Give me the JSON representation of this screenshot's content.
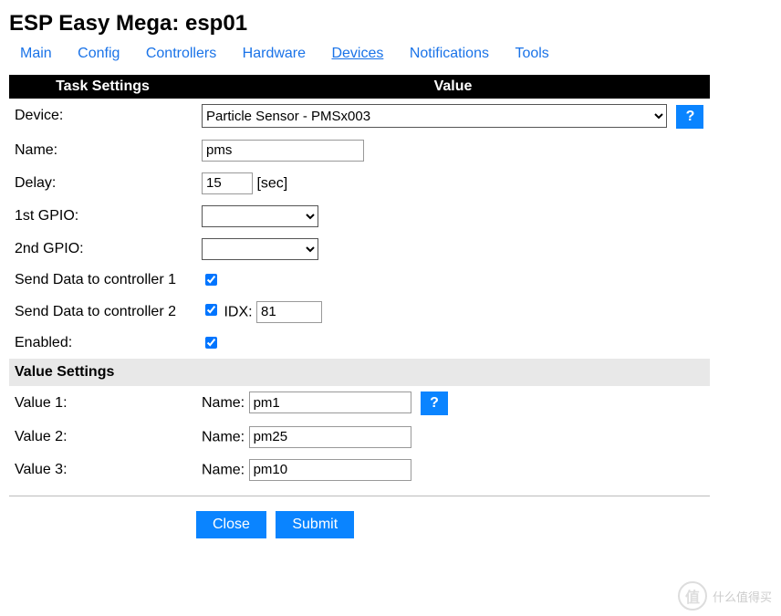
{
  "title": "ESP Easy Mega: esp01",
  "nav": {
    "items": [
      {
        "label": "Main",
        "active": false
      },
      {
        "label": "Config",
        "active": false
      },
      {
        "label": "Controllers",
        "active": false
      },
      {
        "label": "Hardware",
        "active": false
      },
      {
        "label": "Devices",
        "active": true
      },
      {
        "label": "Notifications",
        "active": false
      },
      {
        "label": "Tools",
        "active": false
      }
    ]
  },
  "headers": {
    "task_settings": "Task Settings",
    "value": "Value",
    "value_settings": "Value Settings"
  },
  "labels": {
    "device": "Device:",
    "name": "Name:",
    "delay": "Delay:",
    "delay_unit": "[sec]",
    "gpio1": "1st GPIO:",
    "gpio2": "2nd GPIO:",
    "send1": "Send Data to controller 1",
    "send2": "Send Data to controller 2",
    "idx": "IDX:",
    "enabled": "Enabled:",
    "val_name": "Name:",
    "value1": "Value 1:",
    "value2": "Value 2:",
    "value3": "Value 3:"
  },
  "values": {
    "device": "Particle Sensor - PMSx003",
    "name": "pms",
    "delay": "15",
    "gpio1": "",
    "gpio2": "",
    "send1_checked": true,
    "send2_checked": true,
    "idx": "81",
    "enabled_checked": true,
    "value1_name": "pm1",
    "value2_name": "pm25",
    "value3_name": "pm10"
  },
  "buttons": {
    "help": "?",
    "close": "Close",
    "submit": "Submit"
  },
  "watermark": {
    "icon": "值",
    "text": "什么值得买"
  }
}
